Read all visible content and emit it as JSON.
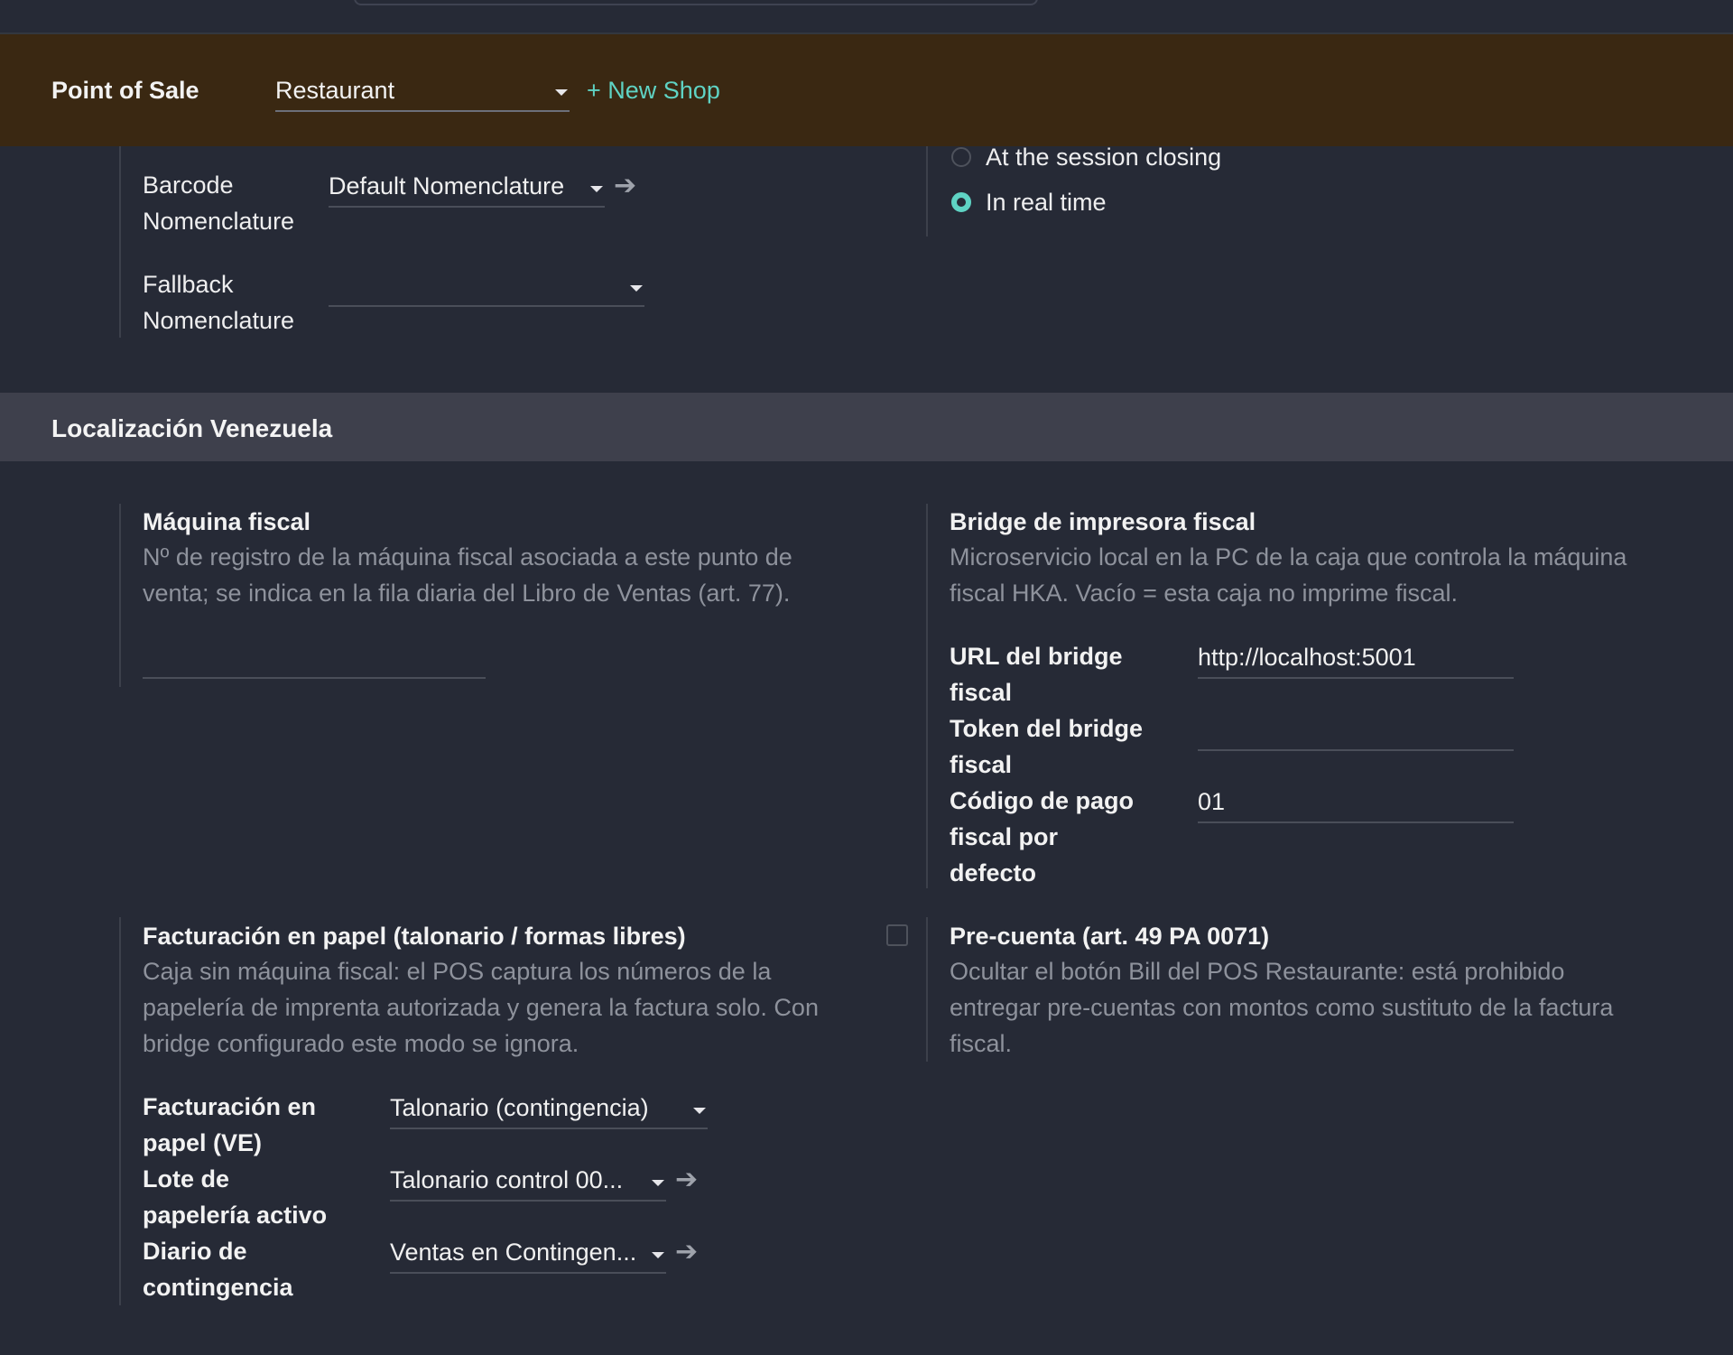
{
  "header": {
    "title": "Point of Sale",
    "shop_value": "Restaurant",
    "new_shop": "+ New Shop"
  },
  "barcode": {
    "barcode_label_1": "Barcode",
    "barcode_label_2": "Nomenclature",
    "barcode_value": "Default Nomenclature",
    "fallback_label_1": "Fallback",
    "fallback_label_2": "Nomenclature",
    "fallback_value": ""
  },
  "update_mode": {
    "opt_closing": "At the session closing",
    "opt_realtime": "In real time",
    "selected": "In real time"
  },
  "section": {
    "title": "Localización Venezuela"
  },
  "maquina": {
    "title": "Máquina fiscal",
    "desc_1": "Nº de registro de la máquina fiscal asociada a este punto de",
    "desc_2": "venta; se indica en la fila diaria del Libro de Ventas (art. 77).",
    "value": ""
  },
  "bridge": {
    "title": "Bridge de impresora fiscal",
    "desc_1": "Microservicio local en la PC de la caja que controla la máquina",
    "desc_2": "fiscal HKA. Vacío = esta caja no imprime fiscal.",
    "url_label_1": "URL del bridge",
    "url_label_2": "fiscal",
    "url_placeholder": "http://localhost:5001",
    "token_label_1": "Token del bridge",
    "token_label_2": "fiscal",
    "token_value": "",
    "code_label_1": "Código de pago",
    "code_label_2": "fiscal por",
    "code_label_3": "defecto",
    "code_value": "01"
  },
  "papel": {
    "title": "Facturación en papel (talonario / formas libres)",
    "desc_1": "Caja sin máquina fiscal: el POS captura los números de la",
    "desc_2": "papelería de imprenta autorizada y genera la factura solo. Con",
    "desc_3": "bridge configurado este modo se ignora.",
    "fact_label_1": "Facturación en",
    "fact_label_2": "papel (VE)",
    "fact_value": "Talonario (contingencia)",
    "lote_label_1": "Lote de",
    "lote_label_2": "papelería activo",
    "lote_value": "Talonario control 00...",
    "diario_label_1": "Diario de",
    "diario_label_2": "contingencia",
    "diario_value": "Ventas en Contingen..."
  },
  "precuenta": {
    "title": "Pre-cuenta (art. 49 PA 0071)",
    "desc_1": "Ocultar el botón Bill del POS Restaurante: está prohibido",
    "desc_2": "entregar pre-cuentas con montos como sustituto de la factura",
    "desc_3": "fiscal.",
    "checked": false
  },
  "icons": {
    "caret": "caret-down-icon",
    "arrow": "arrow-right-icon",
    "arrow_glyph": "➔"
  }
}
